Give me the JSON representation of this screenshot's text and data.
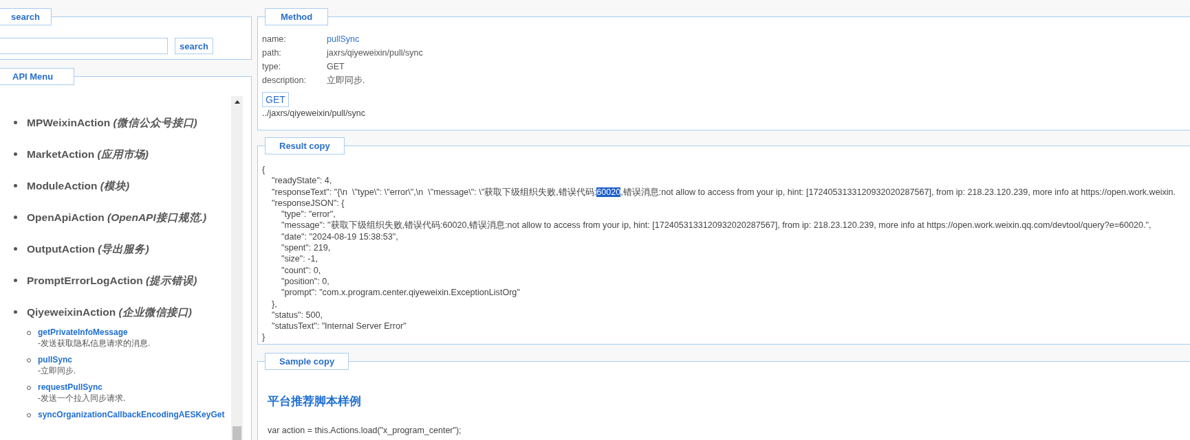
{
  "search_panel": {
    "legend": "search",
    "button": "search"
  },
  "api_menu": {
    "legend": "API Menu",
    "items": [
      {
        "label": "MPWeixinAction *(微信公众号接口)*"
      },
      {
        "label": "MarketAction *(应用市场)*"
      },
      {
        "label": "ModuleAction *(模块)*"
      },
      {
        "label": "OpenApiAction *(OpenAPI接口规范.)*"
      },
      {
        "label": "OutputAction *(导出服务)*"
      },
      {
        "label": "PromptErrorLogAction *(提示错误)*"
      },
      {
        "label": "QiyeweixinAction *(企业微信接口)*",
        "children": [
          {
            "name": "getPrivateInfoMessage",
            "description": "-发送获取隐私信息请求的消息."
          },
          {
            "name": "pullSync",
            "description": "-立即同步."
          },
          {
            "name": "requestPullSync",
            "description": "-发送一个拉入同步请求."
          },
          {
            "name": "syncOrganizationCallbackEncodingAESKeyGet"
          }
        ]
      }
    ]
  },
  "method": {
    "legend": "Method",
    "fields": [
      {
        "label": "name:",
        "value": "pullSync",
        "kind": "link"
      },
      {
        "label": "path:",
        "value": "jaxrs/qiyeweixin/pull/sync",
        "kind": "text"
      },
      {
        "label": "type:",
        "value": "GET",
        "kind": "text"
      },
      {
        "label": "description:",
        "value": "立即同步.",
        "kind": "text"
      }
    ],
    "button": "GET",
    "url": "../jaxrs/qiyeweixin/pull/sync"
  },
  "result": {
    "legend": "Result copy",
    "lines": [
      {
        "parts": [
          {
            "text": "{",
            "selected": false
          }
        ]
      },
      {
        "parts": [
          {
            "text": "    \"readyState\": 4,",
            "selected": false
          }
        ]
      },
      {
        "parts": [
          {
            "text": "    \"responseText\": \"{\\n  \\\"type\\\": \\\"error\\\",\\n  \\\"message\\\": \\\"获取下级组织失败,错误代码:",
            "selected": false
          },
          {
            "text": "60020",
            "selected": true
          },
          {
            "text": ",错误消息:not allow to access from your ip, hint: [1724053133120932020287567], from ip: 218.23.120.239, more info at https://open.work.weixin.",
            "selected": false
          }
        ]
      },
      {
        "parts": [
          {
            "text": "    \"responseJSON\": {",
            "selected": false
          }
        ]
      },
      {
        "parts": [
          {
            "text": "        \"type\": \"error\",",
            "selected": false
          }
        ]
      },
      {
        "parts": [
          {
            "text": "        \"message\": \"获取下级组织失败,错误代码:60020,错误消息:not allow to access from your ip, hint: [1724053133120932020287567], from ip: 218.23.120.239, more info at https://open.work.weixin.qq.com/devtool/query?e=60020.\",",
            "selected": false
          }
        ]
      },
      {
        "parts": [
          {
            "text": "        \"date\": \"2024-08-19 15:38:53\",",
            "selected": false
          }
        ]
      },
      {
        "parts": [
          {
            "text": "        \"spent\": 219,",
            "selected": false
          }
        ]
      },
      {
        "parts": [
          {
            "text": "        \"size\": -1,",
            "selected": false
          }
        ]
      },
      {
        "parts": [
          {
            "text": "        \"count\": 0,",
            "selected": false
          }
        ]
      },
      {
        "parts": [
          {
            "text": "        \"position\": 0,",
            "selected": false
          }
        ]
      },
      {
        "parts": [
          {
            "text": "        \"prompt\": \"com.x.program.center.qiyeweixin.ExceptionListOrg\"",
            "selected": false
          }
        ]
      },
      {
        "parts": [
          {
            "text": "    },",
            "selected": false
          }
        ]
      },
      {
        "parts": [
          {
            "text": "    \"status\": 500,",
            "selected": false
          }
        ]
      },
      {
        "parts": [
          {
            "text": "    \"statusText\": \"Internal Server Error\"",
            "selected": false
          }
        ]
      },
      {
        "parts": [
          {
            "text": "}",
            "selected": false
          }
        ]
      }
    ]
  },
  "sample": {
    "legend": "Sample copy",
    "heading": "平台推荐脚本样例",
    "code": "var action = this.Actions.load(\"x_program_center\");"
  }
}
